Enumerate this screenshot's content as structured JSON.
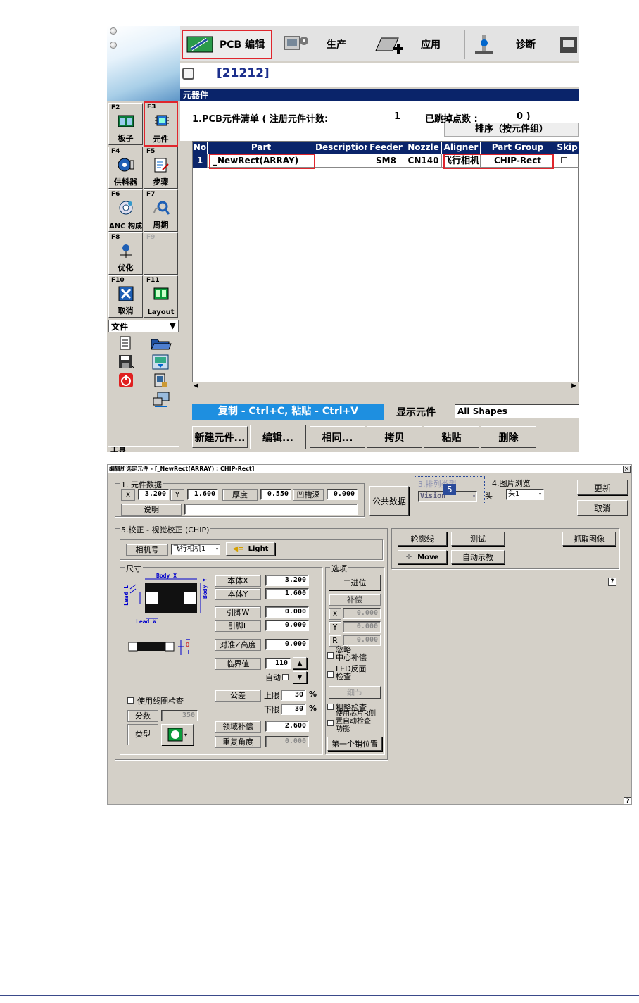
{
  "top_window": {
    "toolbar": [
      {
        "label": "PCB 编辑",
        "active": true
      },
      {
        "label": "生产"
      },
      {
        "label": "应用"
      },
      {
        "label": "诊断"
      }
    ],
    "job_id": "[21212]",
    "panel_title": "元器件",
    "side_buttons": [
      {
        "key": "F2",
        "label": "板子",
        "icon": "board-icon"
      },
      {
        "key": "F3",
        "label": "元件",
        "icon": "chip-icon",
        "highlighted": true
      },
      {
        "key": "F4",
        "label": "供料器",
        "icon": "feeder-icon"
      },
      {
        "key": "F5",
        "label": "步骤",
        "icon": "step-icon"
      },
      {
        "key": "F6",
        "label": "ANC 构成",
        "icon": "anc-icon"
      },
      {
        "key": "F7",
        "label": "周期",
        "icon": "cycle-icon"
      },
      {
        "key": "F8",
        "label": "优化",
        "icon": "optimize-icon"
      },
      {
        "key": "F9",
        "label": "",
        "icon": ""
      },
      {
        "key": "F10",
        "label": "取消",
        "icon": "cancel-icon"
      },
      {
        "key": "F11",
        "label": "Layout",
        "icon": "layout-icon"
      }
    ],
    "file_menu": "文件",
    "tools_menu": "工具",
    "list_header": {
      "title": "1.PCB元件清单 ( 注册元件计数:",
      "count": "1",
      "skipped_label": "已跳掉点数 :",
      "skipped_value": "0 )",
      "sort_label": "排序（按元件组）"
    },
    "table": {
      "columns": [
        "No",
        "Part",
        "Description",
        "Feeder",
        "Nozzle",
        "Aligner",
        "Part Group",
        "Skip"
      ],
      "rows": [
        {
          "no": "1",
          "part": "_NewRect(ARRAY)",
          "description": "",
          "feeder": "SM8",
          "nozzle": "CN140",
          "aligner": "飞行相机",
          "part_group": "CHIP-Rect",
          "skip": false
        }
      ]
    },
    "hint_bar": "复制 - Ctrl+C, 粘贴 - Ctrl+V",
    "show_label": "显示元件",
    "show_value": "All Shapes",
    "buttons": [
      "新建元件...",
      "编辑...",
      "相同...",
      "拷贝",
      "粘贴",
      "删除"
    ]
  },
  "dialog": {
    "title": "编辑所选定元件 - [_NewRect(ARRAY) : CHIP-Rect]",
    "close": "×",
    "group1": {
      "title": "1. 元件数据",
      "x_label": "X",
      "x_value": "3.200",
      "y_label": "Y",
      "y_value": "1.600",
      "thickness_label": "厚度",
      "thickness_value": "0.550",
      "groove_label": "凹槽深",
      "groove_value": "0.000",
      "desc_label": "说明",
      "desc_value": ""
    },
    "common_data_button": "公共数据",
    "group3": {
      "title": "3.排列类型",
      "value": "Vision",
      "badge": "5",
      "head_label": "头"
    },
    "group4": {
      "title": "4.图片浏览",
      "head_value": "头1"
    },
    "update_button": "更新",
    "cancel_button": "取消",
    "group5": {
      "title": "5.校正 - 视觉校正 (CHIP)",
      "camera_label": "相机号",
      "camera_value": "飞行相机1",
      "light_button": "Light",
      "size_group": "尺寸",
      "diagram": {
        "body_x": "Body X",
        "body_y": "Body Y",
        "lead_l": "Lead L",
        "lead_w": "Lead W"
      },
      "fields": [
        {
          "label": "本体X",
          "value": "3.200"
        },
        {
          "label": "本体Y",
          "value": "1.600"
        },
        {
          "label": "引脚W",
          "value": "0.000"
        },
        {
          "label": "引脚L",
          "value": "0.000"
        },
        {
          "label": "对准Z高度",
          "value": "0.000"
        }
      ],
      "threshold_label": "临界值",
      "threshold_value": "110",
      "auto_label": "自动",
      "tolerance_label": "公差",
      "upper_label": "上限",
      "upper_value": "30",
      "lower_label": "下限",
      "lower_value": "30",
      "pct": "%",
      "field_comp_label": "领域补偿",
      "field_comp_value": "2.600",
      "repeat_label": "重复角度",
      "repeat_value": "0.000",
      "coil_check": "使用线圈检查",
      "score_label": "分数",
      "score_value": "350",
      "type_label": "类型",
      "options_group": "选项",
      "binary_button": "二进位",
      "comp_label": "补偿",
      "comp_x": "0.000",
      "comp_y": "0.000",
      "comp_r": "0.000",
      "xyr": [
        "X",
        "Y",
        "R"
      ],
      "ignore_center": "忽略\n中心补偿",
      "led_check": "LED反面\n检查",
      "detail_button": "细节",
      "rough_check": "粗略检查",
      "chip_r_check": "使用芯片R侧\n置自动检查\n功能",
      "first_pin_button": "第一个销位置"
    },
    "right_panel": {
      "outline_button": "轮廓线",
      "test_button": "测试",
      "grab_button": "抓取图像",
      "move_button": "Move",
      "auto_teach_button": "自动示教"
    },
    "help": "?"
  }
}
